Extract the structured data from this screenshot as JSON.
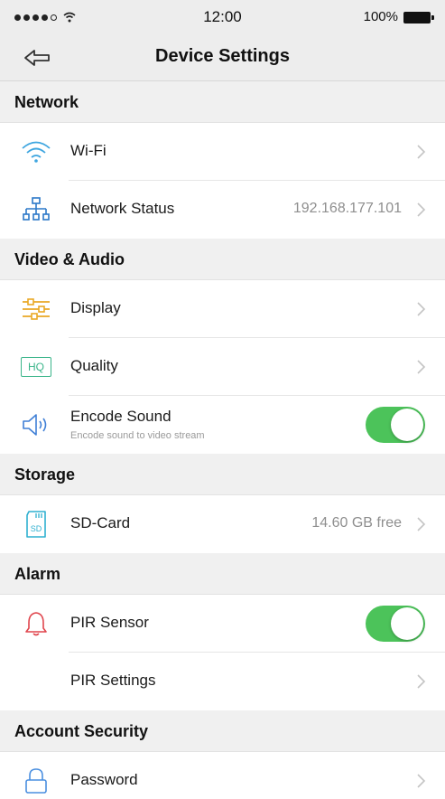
{
  "status_bar": {
    "time": "12:00",
    "battery": "100%"
  },
  "nav": {
    "title": "Device Settings",
    "back_icon": "back-arrow-icon"
  },
  "sections": {
    "network": {
      "title": "Network",
      "wifi": {
        "label": "Wi-Fi"
      },
      "network_status": {
        "label": "Network Status",
        "value": "192.168.177.101"
      }
    },
    "video_audio": {
      "title": "Video & Audio",
      "display": {
        "label": "Display"
      },
      "quality": {
        "label": "Quality",
        "icon_text": "HQ"
      },
      "encode_sound": {
        "label": "Encode Sound",
        "sublabel": "Encode sound to video stream",
        "enabled": true
      }
    },
    "storage": {
      "title": "Storage",
      "sd_card": {
        "label": "SD-Card",
        "value": "14.60 GB free",
        "icon_text": "SD"
      }
    },
    "alarm": {
      "title": "Alarm",
      "pir_sensor": {
        "label": "PIR Sensor",
        "enabled": true
      },
      "pir_settings": {
        "label": "PIR Settings"
      }
    },
    "account_security": {
      "title": "Account Security",
      "password": {
        "label": "Password"
      }
    }
  },
  "colors": {
    "wifi_icon": "#3fa6e0",
    "network_icon": "#2b78c8",
    "display_icon": "#e9a825",
    "quality_icon": "#3bb58a",
    "sound_icon": "#3f7fd6",
    "sd_icon": "#2fb0d0",
    "alarm_icon": "#e0454d",
    "password_icon": "#4a8fe0",
    "toggle_on": "#4cc35a"
  }
}
